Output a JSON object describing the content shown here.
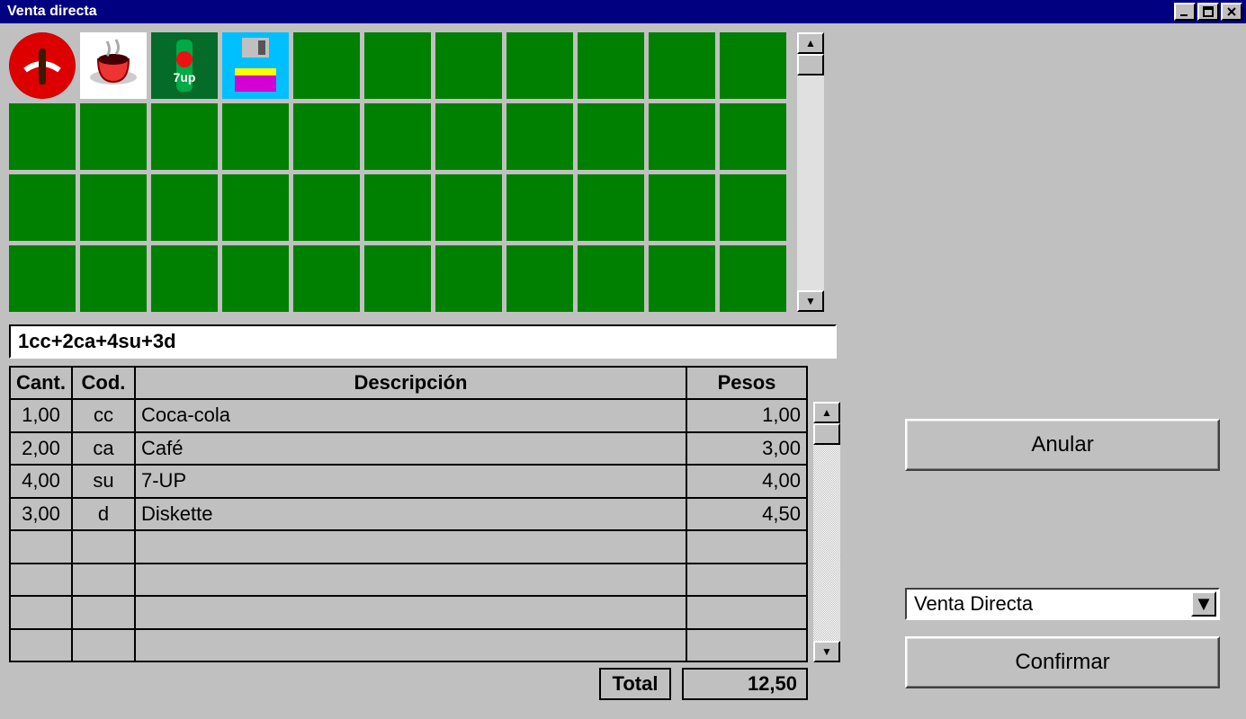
{
  "window": {
    "title": "Venta directa"
  },
  "products": [
    {
      "name": "coke",
      "iconClass": "icon-coke"
    },
    {
      "name": "coffee",
      "iconClass": "icon-coffee"
    },
    {
      "name": "sevenup",
      "iconClass": "icon-sevenup"
    },
    {
      "name": "diskette",
      "iconClass": "icon-disk"
    }
  ],
  "grid": {
    "totalCells": 44
  },
  "command": "1cc+2ca+4su+3d",
  "table": {
    "headers": {
      "qty": "Cant.",
      "code": "Cod.",
      "desc": "Descripción",
      "price": "Pesos"
    },
    "rows": [
      {
        "qty": "1,00",
        "code": "cc",
        "desc": "Coca-cola",
        "price": "1,00"
      },
      {
        "qty": "2,00",
        "code": "ca",
        "desc": "Café",
        "price": "3,00"
      },
      {
        "qty": "4,00",
        "code": "su",
        "desc": "7-UP",
        "price": "4,00"
      },
      {
        "qty": "3,00",
        "code": "d",
        "desc": "Diskette",
        "price": "4,50"
      }
    ],
    "emptyRows": 4,
    "totalLabel": "Total",
    "totalValue": "12,50"
  },
  "side": {
    "anular": "Anular",
    "saleType": "Venta Directa",
    "confirm": "Confirmar"
  }
}
